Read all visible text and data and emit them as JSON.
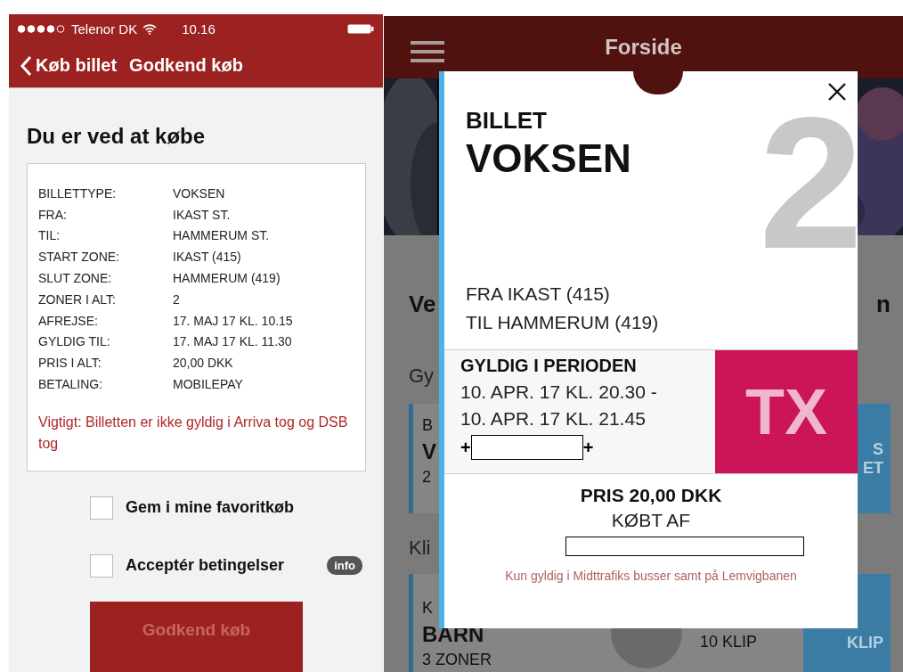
{
  "left_screen": {
    "status_bar": {
      "carrier": "Telenor DK",
      "time": "10.16"
    },
    "nav_bar": {
      "back_label": "Køb billet",
      "title": "Godkend køb"
    },
    "heading": "Du er ved at købe",
    "details": [
      {
        "label": "BILLETTYPE:",
        "value": "VOKSEN"
      },
      {
        "label": "FRA:",
        "value": "IKAST ST."
      },
      {
        "label": "TIL:",
        "value": "HAMMERUM ST."
      },
      {
        "label": "START ZONE:",
        "value": "IKAST (415)"
      },
      {
        "label": "SLUT ZONE:",
        "value": "HAMMERUM (419)"
      },
      {
        "label": "ZONER I ALT:",
        "value": "2"
      },
      {
        "label": "AFREJSE:",
        "value": "17. MAJ 17 KL. 10.15"
      },
      {
        "label": "GYLDIG TIL:",
        "value": "17. MAJ 17 KL. 11.30"
      },
      {
        "label": "PRIS I ALT:",
        "value": "20,00 DKK"
      },
      {
        "label": "BETALING:",
        "value": "MOBILEPAY"
      }
    ],
    "notice": "Vigtigt: Billetten er ikke gyldig i Arriva tog og DSB tog",
    "options": [
      {
        "label": "Gem i mine favoritkøb",
        "checked": false
      },
      {
        "label": "Acceptér betingelser",
        "checked": false,
        "info_badge": "info"
      }
    ],
    "confirm_button": {
      "label": "Godkend køb",
      "disabled": true
    }
  },
  "right_screen": {
    "header": {
      "title": "Forside"
    },
    "background": {
      "section_title_start": "Ve",
      "section_title_end": "n",
      "groups": [
        {
          "label": "Gy",
          "card_lines": [
            "B",
            "V",
            "2"
          ],
          "button_lines": [
            "S",
            "ET"
          ]
        },
        {
          "label": "Kli",
          "card_lines": [
            "K",
            "BARN",
            "3 ZONER"
          ],
          "count": "10 KLIP",
          "button_lines": [
            "KLIP"
          ]
        }
      ]
    },
    "ticket": {
      "label": "BILLET",
      "type": "VOKSEN",
      "zone_count": "2",
      "from": "FRA IKAST (415)",
      "to": "TIL HAMMERUM (419)",
      "period_heading": "GYLDIG I PERIODEN",
      "period_lines": [
        "10. APR. 17 KL. 20.30 -",
        "10. APR. 17 KL. 21.45"
      ],
      "code_prefix": "+",
      "code_suffix": "+",
      "operator_logo": "TX",
      "price": "PRIS 20,00 DKK",
      "bought_by": "KØBT AF",
      "validity_note": "Kun gyldig i Midttrafiks busser samt på Lemvigbanen"
    }
  }
}
